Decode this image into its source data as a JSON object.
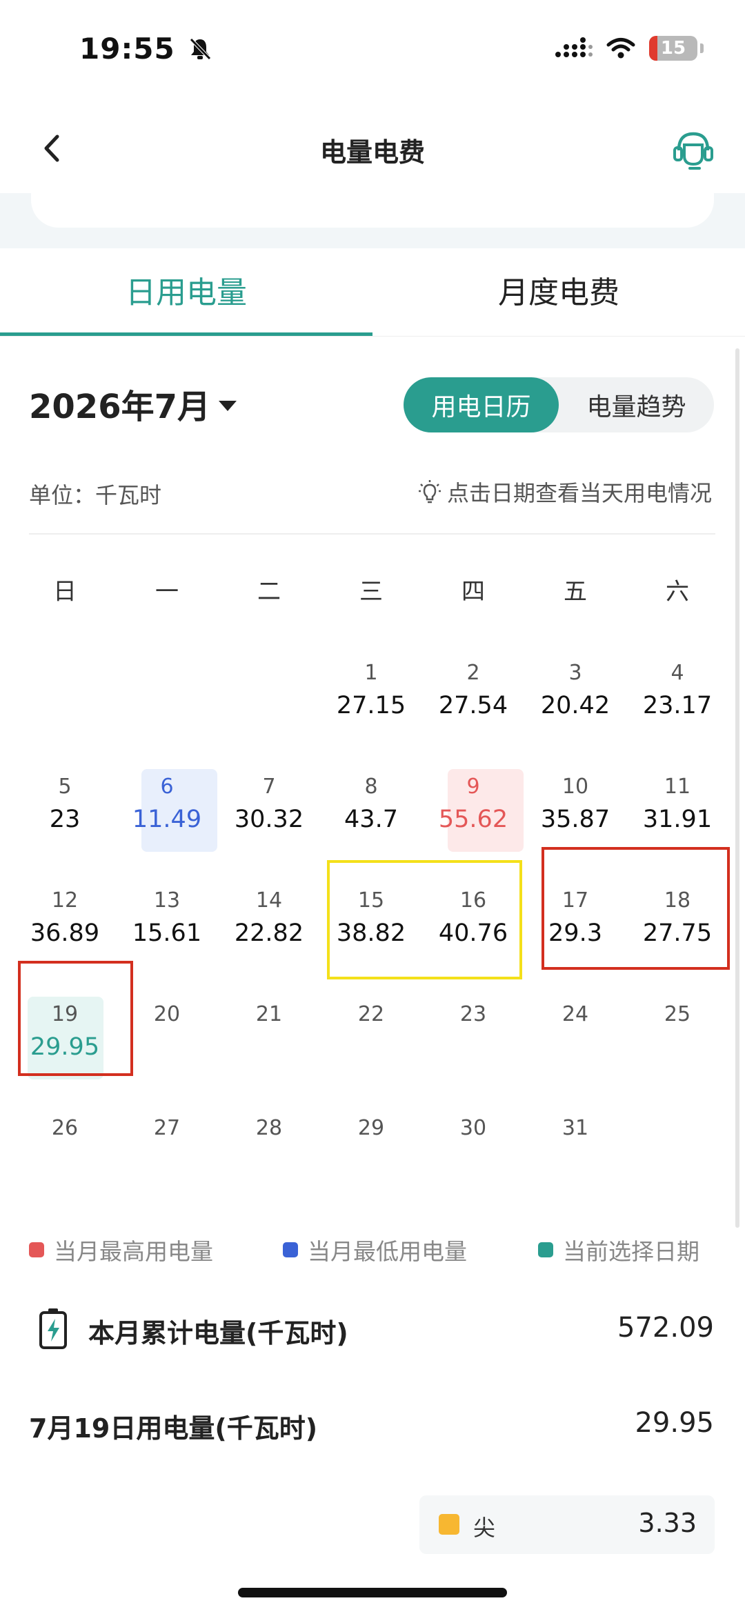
{
  "status_bar": {
    "time": "19:55",
    "battery": "15"
  },
  "nav": {
    "title": "电量电费"
  },
  "tabs": [
    {
      "label": "日用电量"
    },
    {
      "label": "月度电费"
    }
  ],
  "month": {
    "label": "2026年7月"
  },
  "view_toggle": {
    "calendar": "用电日历",
    "trend": "电量趋势"
  },
  "unit": "单位：千瓦时",
  "hint": "点击日期查看当天用电情况",
  "weekdays": [
    "日",
    "一",
    "二",
    "三",
    "四",
    "五",
    "六"
  ],
  "days": [
    {
      "day": "1",
      "value": "27.15"
    },
    {
      "day": "2",
      "value": "27.54"
    },
    {
      "day": "3",
      "value": "20.42"
    },
    {
      "day": "4",
      "value": "23.17"
    },
    {
      "day": "5",
      "value": "23"
    },
    {
      "day": "6",
      "value": "11.49"
    },
    {
      "day": "7",
      "value": "30.32"
    },
    {
      "day": "8",
      "value": "43.7"
    },
    {
      "day": "9",
      "value": "55.62"
    },
    {
      "day": "10",
      "value": "35.87"
    },
    {
      "day": "11",
      "value": "31.91"
    },
    {
      "day": "12",
      "value": "36.89"
    },
    {
      "day": "13",
      "value": "15.61"
    },
    {
      "day": "14",
      "value": "22.82"
    },
    {
      "day": "15",
      "value": "38.82"
    },
    {
      "day": "16",
      "value": "40.76"
    },
    {
      "day": "17",
      "value": "29.3"
    },
    {
      "day": "18",
      "value": "27.75"
    },
    {
      "day": "19",
      "value": "29.95"
    },
    {
      "day": "20",
      "value": ""
    },
    {
      "day": "21",
      "value": ""
    },
    {
      "day": "22",
      "value": ""
    },
    {
      "day": "23",
      "value": ""
    },
    {
      "day": "24",
      "value": ""
    },
    {
      "day": "25",
      "value": ""
    },
    {
      "day": "26",
      "value": ""
    },
    {
      "day": "27",
      "value": ""
    },
    {
      "day": "28",
      "value": ""
    },
    {
      "day": "29",
      "value": ""
    },
    {
      "day": "30",
      "value": ""
    },
    {
      "day": "31",
      "value": ""
    }
  ],
  "legend": {
    "highest": "当月最高用电量",
    "lowest": "当月最低用电量",
    "selected": "当前选择日期"
  },
  "colors": {
    "accent": "#2a9d8f",
    "highest": "#e45757",
    "lowest": "#3a62d6",
    "highest_bg": "#fde9e9",
    "lowest_bg": "#e8effc",
    "selected_bg": "#e6f5f3",
    "peak": "#f7b731"
  },
  "summary": {
    "monthly_label": "本月累计电量(千瓦时)",
    "monthly_value": "572.09",
    "day_label": "7月19日用电量(千瓦时)",
    "day_value": "29.95"
  },
  "peak": {
    "label": "尖",
    "value": "3.33"
  }
}
